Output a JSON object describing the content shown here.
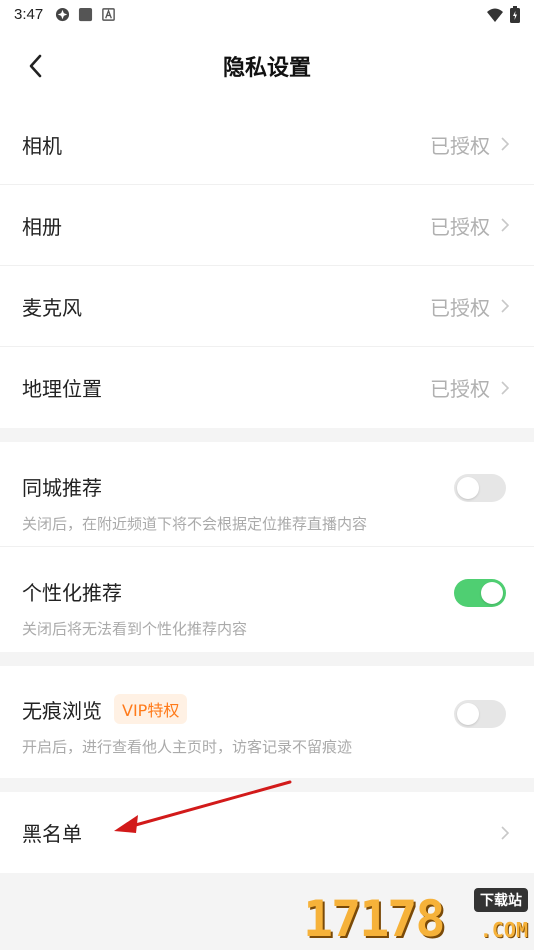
{
  "status_bar": {
    "time": "3:47",
    "icons_left": [
      "pinwheel-icon",
      "square-icon",
      "a-box-icon"
    ],
    "icons_right": [
      "wifi-icon",
      "battery-icon"
    ]
  },
  "header": {
    "title": "隐私设置",
    "back_icon": "chevron-left-icon"
  },
  "permissions": [
    {
      "label": "相机",
      "status": "已授权"
    },
    {
      "label": "相册",
      "status": "已授权"
    },
    {
      "label": "麦克风",
      "status": "已授权"
    },
    {
      "label": "地理位置",
      "status": "已授权"
    }
  ],
  "recommend": [
    {
      "title": "同城推荐",
      "desc": "关闭后，在附近频道下将不会根据定位推荐直播内容",
      "on": false
    },
    {
      "title": "个性化推荐",
      "desc": "关闭后将无法看到个性化推荐内容",
      "on": true
    }
  ],
  "incognito": {
    "title": "无痕浏览",
    "badge": "VIP特权",
    "desc": "开启后，进行查看他人主页时，访客记录不留痕迹",
    "on": false
  },
  "blacklist": {
    "label": "黑名单"
  },
  "watermark": {
    "digits": "17178",
    "tag": "下载站",
    "domain": ".COM"
  },
  "colors": {
    "toggle_on": "#4fcf72",
    "toggle_off": "#e6e6e6",
    "vip_text": "#ff7a1a",
    "annotation_arrow": "#d21a1a"
  }
}
